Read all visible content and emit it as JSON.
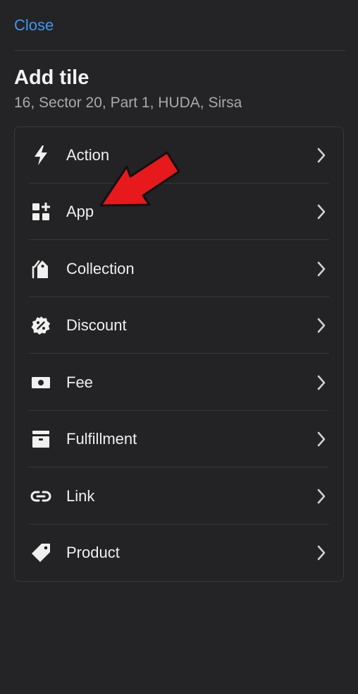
{
  "header": {
    "close_label": "Close",
    "title": "Add tile",
    "subtitle": "16, Sector 20, Part 1, HUDA, Sirsa"
  },
  "tiles": [
    {
      "label": "Action",
      "icon": "lightning-icon"
    },
    {
      "label": "App",
      "icon": "apps-grid-icon"
    },
    {
      "label": "Collection",
      "icon": "collection-tag-icon"
    },
    {
      "label": "Discount",
      "icon": "discount-badge-icon"
    },
    {
      "label": "Fee",
      "icon": "cash-icon"
    },
    {
      "label": "Fulfillment",
      "icon": "fulfillment-box-icon"
    },
    {
      "label": "Link",
      "icon": "link-icon"
    },
    {
      "label": "Product",
      "icon": "product-tag-icon"
    }
  ],
  "annotation": {
    "arrow_color": "#e8191c",
    "points_to": "App"
  },
  "colors": {
    "background": "#242426",
    "accent": "#3d97ee",
    "text": "#efefef",
    "muted_text": "#a9a9ad"
  }
}
